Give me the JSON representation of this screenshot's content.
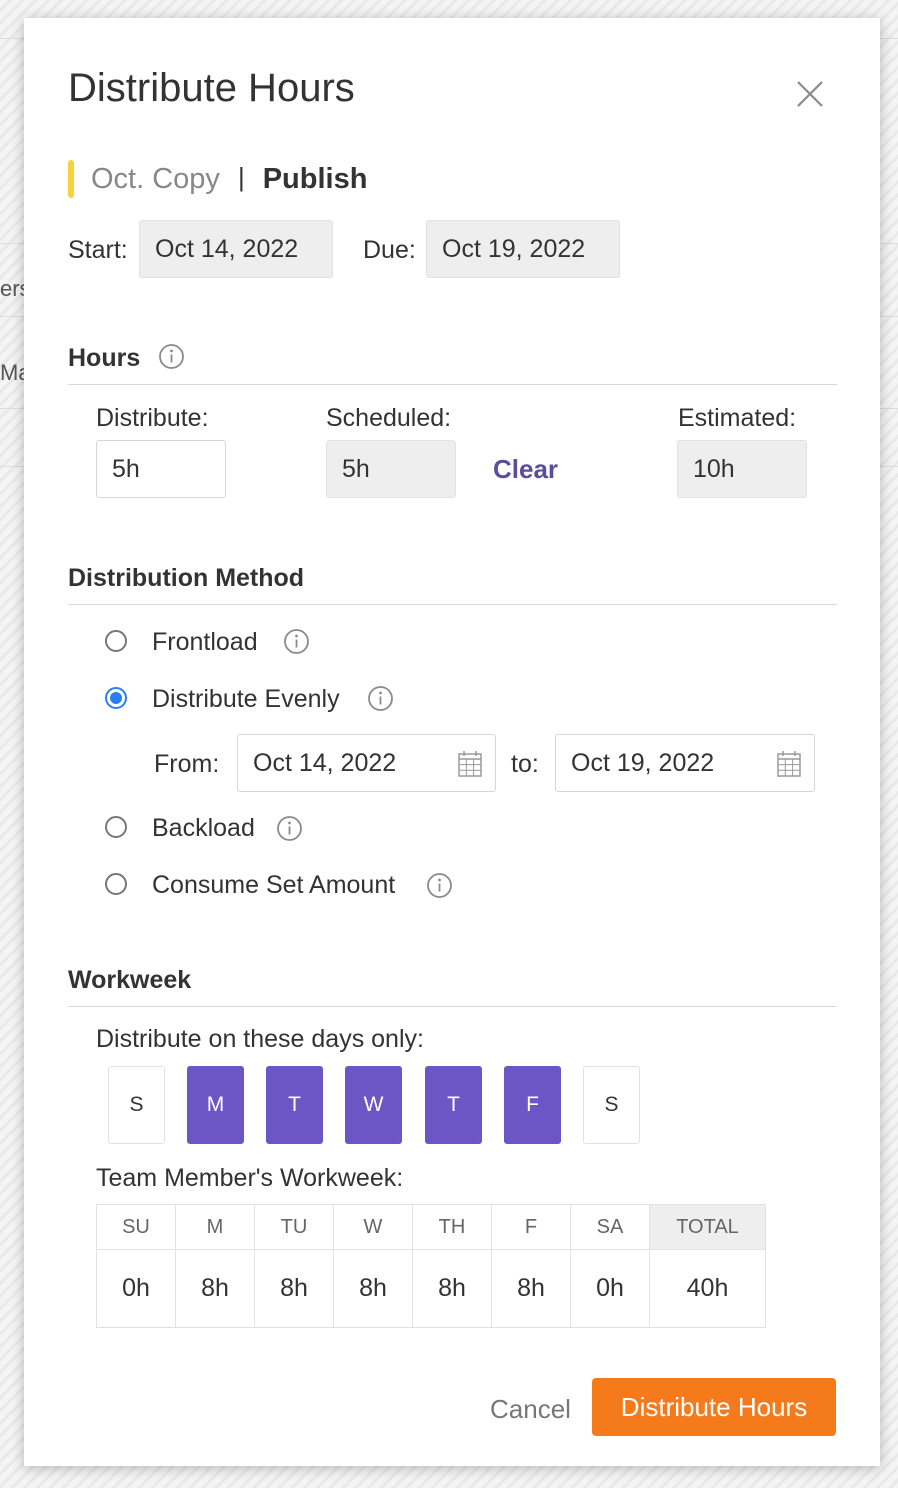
{
  "modal": {
    "title": "Distribute Hours",
    "project": "Oct. Copy",
    "separator": "|",
    "phase": "Publish",
    "start_label": "Start:",
    "start_value": "Oct 14, 2022",
    "due_label": "Due:",
    "due_value": "Oct 19, 2022"
  },
  "hours": {
    "title": "Hours",
    "distribute_label": "Distribute:",
    "distribute_value": "5h",
    "scheduled_label": "Scheduled:",
    "scheduled_value": "5h",
    "clear_label": "Clear",
    "estimated_label": "Estimated:",
    "estimated_value": "10h"
  },
  "method": {
    "title": "Distribution Method",
    "options": [
      {
        "label": "Frontload",
        "checked": false
      },
      {
        "label": "Distribute Evenly",
        "checked": true
      },
      {
        "label": "Backload",
        "checked": false
      },
      {
        "label": "Consume Set Amount",
        "checked": false
      }
    ],
    "from_label": "From:",
    "from_value": "Oct 14, 2022",
    "to_label": "to:",
    "to_value": "Oct 19, 2022"
  },
  "workweek": {
    "title": "Workweek",
    "days_label": "Distribute on these days only:",
    "days": [
      {
        "label": "S",
        "on": false
      },
      {
        "label": "M",
        "on": true
      },
      {
        "label": "T",
        "on": true
      },
      {
        "label": "W",
        "on": true
      },
      {
        "label": "T",
        "on": true
      },
      {
        "label": "F",
        "on": true
      },
      {
        "label": "S",
        "on": false
      }
    ],
    "team_label": "Team Member's Workweek:",
    "headers": [
      "SU",
      "M",
      "TU",
      "W",
      "TH",
      "F",
      "SA",
      "TOTAL"
    ],
    "values": [
      "0h",
      "8h",
      "8h",
      "8h",
      "8h",
      "8h",
      "0h",
      "40h"
    ]
  },
  "footer": {
    "cancel_label": "Cancel",
    "submit_label": "Distribute Hours"
  },
  "background": {
    "fragment_1": "ers",
    "fragment_2": "Ma"
  },
  "colors": {
    "accent_purple": "#6c55c4",
    "primary_orange": "#f47a1b",
    "project_yellow": "#f7d23c",
    "radio_blue": "#2a7ff0"
  }
}
